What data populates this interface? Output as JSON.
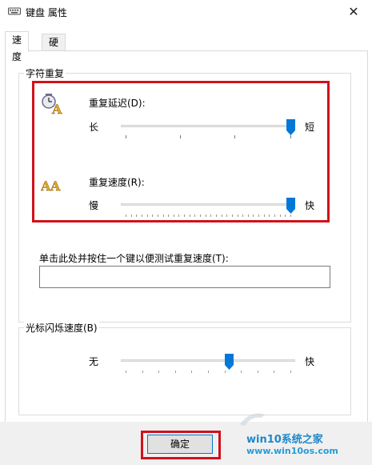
{
  "window": {
    "title": "键盘 属性",
    "close_label": "✕"
  },
  "tabs": [
    {
      "label": "速度",
      "active": true
    },
    {
      "label": "硬件",
      "active": false
    }
  ],
  "repeat_group": {
    "title": "字符重复",
    "delay": {
      "label": "重复延迟(D):",
      "left": "长",
      "right": "短",
      "value": 1.0,
      "icon": "repeat-delay-icon"
    },
    "rate": {
      "label": "重复速度(R):",
      "left": "慢",
      "right": "快",
      "value": 1.0,
      "icon": "repeat-rate-icon"
    },
    "test": {
      "label": "单击此处并按住一个键以便测试重复速度(T):",
      "value": ""
    }
  },
  "cursor_group": {
    "title": "光标闪烁速度(B)",
    "left": "无",
    "right": "快",
    "value": 0.63
  },
  "footer": {
    "ok_label": "确定"
  },
  "watermark": {
    "name": "win10系统之家",
    "url": "www.win10os.com"
  },
  "colors": {
    "accent": "#0078d7",
    "highlight": "#d0121b"
  }
}
